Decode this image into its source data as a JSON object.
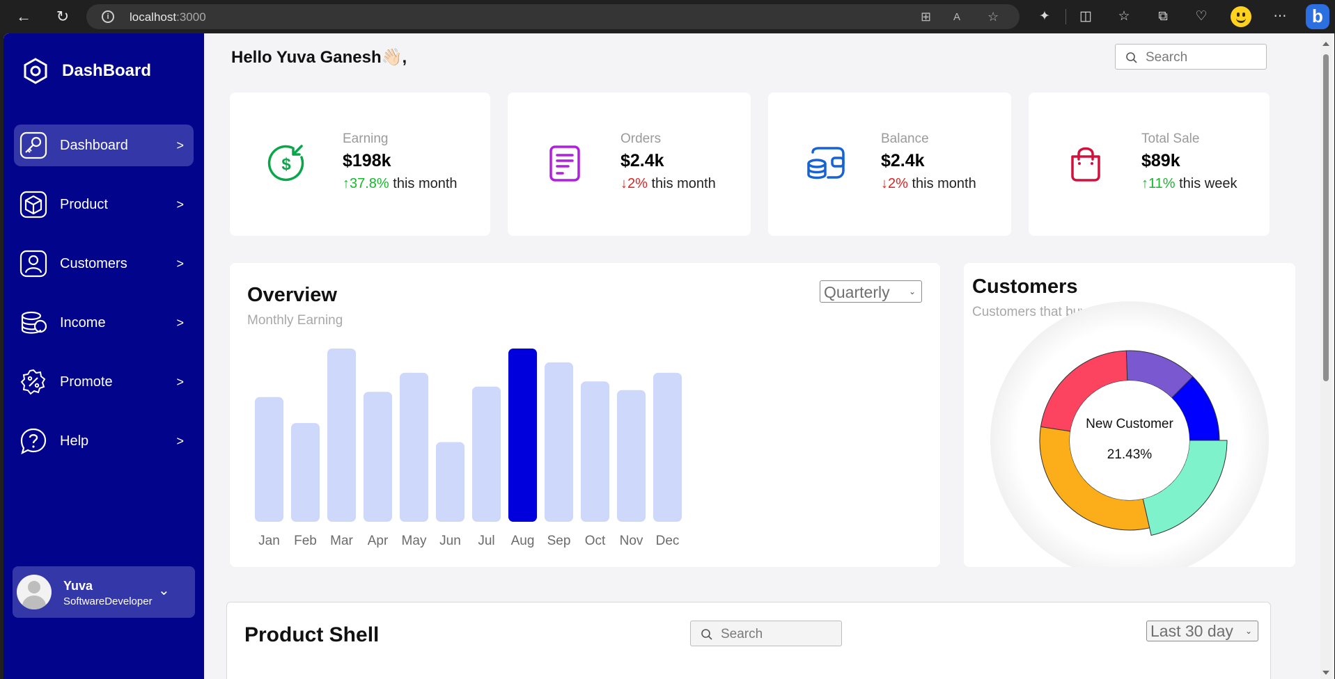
{
  "browser": {
    "url_host": "localhost",
    "url_port": ":3000"
  },
  "sidebar": {
    "brand": "DashBoard",
    "items": [
      {
        "label": "Dashboard",
        "icon": "key-icon",
        "active": true
      },
      {
        "label": "Product",
        "icon": "cube-icon",
        "active": false
      },
      {
        "label": "Customers",
        "icon": "user-icon",
        "active": false
      },
      {
        "label": "Income",
        "icon": "coins-icon",
        "active": false
      },
      {
        "label": "Promote",
        "icon": "discount-badge-icon",
        "active": false
      },
      {
        "label": "Help",
        "icon": "help-bubble-icon",
        "active": false
      }
    ],
    "user": {
      "name": "Yuva",
      "role": "SoftwareDeveloper"
    }
  },
  "header": {
    "greeting": "Hello Yuva Ganesh👋🏻,",
    "search_placeholder": "Search"
  },
  "stats": [
    {
      "title": "Earning",
      "value": "$198k",
      "arrow": "↑",
      "change": "37.8%",
      "period": " this month",
      "trend": "up",
      "icon": "dollar-arrow-icon",
      "bg": "#e0fbe9",
      "color": "#0ba54a"
    },
    {
      "title": "Orders",
      "value": "$2.4k",
      "arrow": "↓",
      "change": "2%",
      "period": " this month",
      "trend": "down",
      "icon": "document-icon",
      "bg": "#e6dcfb",
      "color": "#b11ee0"
    },
    {
      "title": "Balance",
      "value": "$2.4k",
      "arrow": "↓",
      "change": "2%",
      "period": " this month",
      "trend": "down",
      "icon": "wallet-icon",
      "bg": "#cdf0fb",
      "color": "#1563d6"
    },
    {
      "title": "Total Sale",
      "value": "$89k",
      "arrow": "↑",
      "change": "11%",
      "period": " this week",
      "trend": "up",
      "icon": "shopping-bag-icon",
      "bg": "#fcc8e2",
      "color": "#d3103c"
    }
  ],
  "overview": {
    "title": "Overview",
    "subtitle": "Monthly Earning",
    "select_value": "Quarterly"
  },
  "customers": {
    "title": "Customers",
    "subtitle": "Customers that buy products",
    "center_label": "New Customer",
    "center_value": "21.43%"
  },
  "product_shell": {
    "title": "Product Shell",
    "search_placeholder": "Search",
    "select_value": "Last 30 day"
  },
  "chart_data": [
    {
      "type": "bar",
      "categories": [
        "Jan",
        "Feb",
        "Mar",
        "Apr",
        "May",
        "Jun",
        "Jul",
        "Aug",
        "Sep",
        "Oct",
        "Nov",
        "Dec"
      ],
      "values": [
        72,
        57,
        100,
        75,
        86,
        46,
        78,
        100,
        92,
        81,
        76,
        86
      ],
      "highlight_index": 7,
      "bar_color": "#cdd8fb",
      "highlight_color": "#0000dd",
      "ylim": [
        0,
        100
      ]
    },
    {
      "type": "pie",
      "labels": [
        "",
        "",
        "",
        "",
        ""
      ],
      "values": [
        21.43,
        31,
        22,
        13,
        12.57
      ],
      "colors": [
        "#7ef2cb",
        "#fbad1a",
        "#fc4461",
        "#7958d0",
        "#0000ff"
      ],
      "highlight_index": 0
    }
  ]
}
